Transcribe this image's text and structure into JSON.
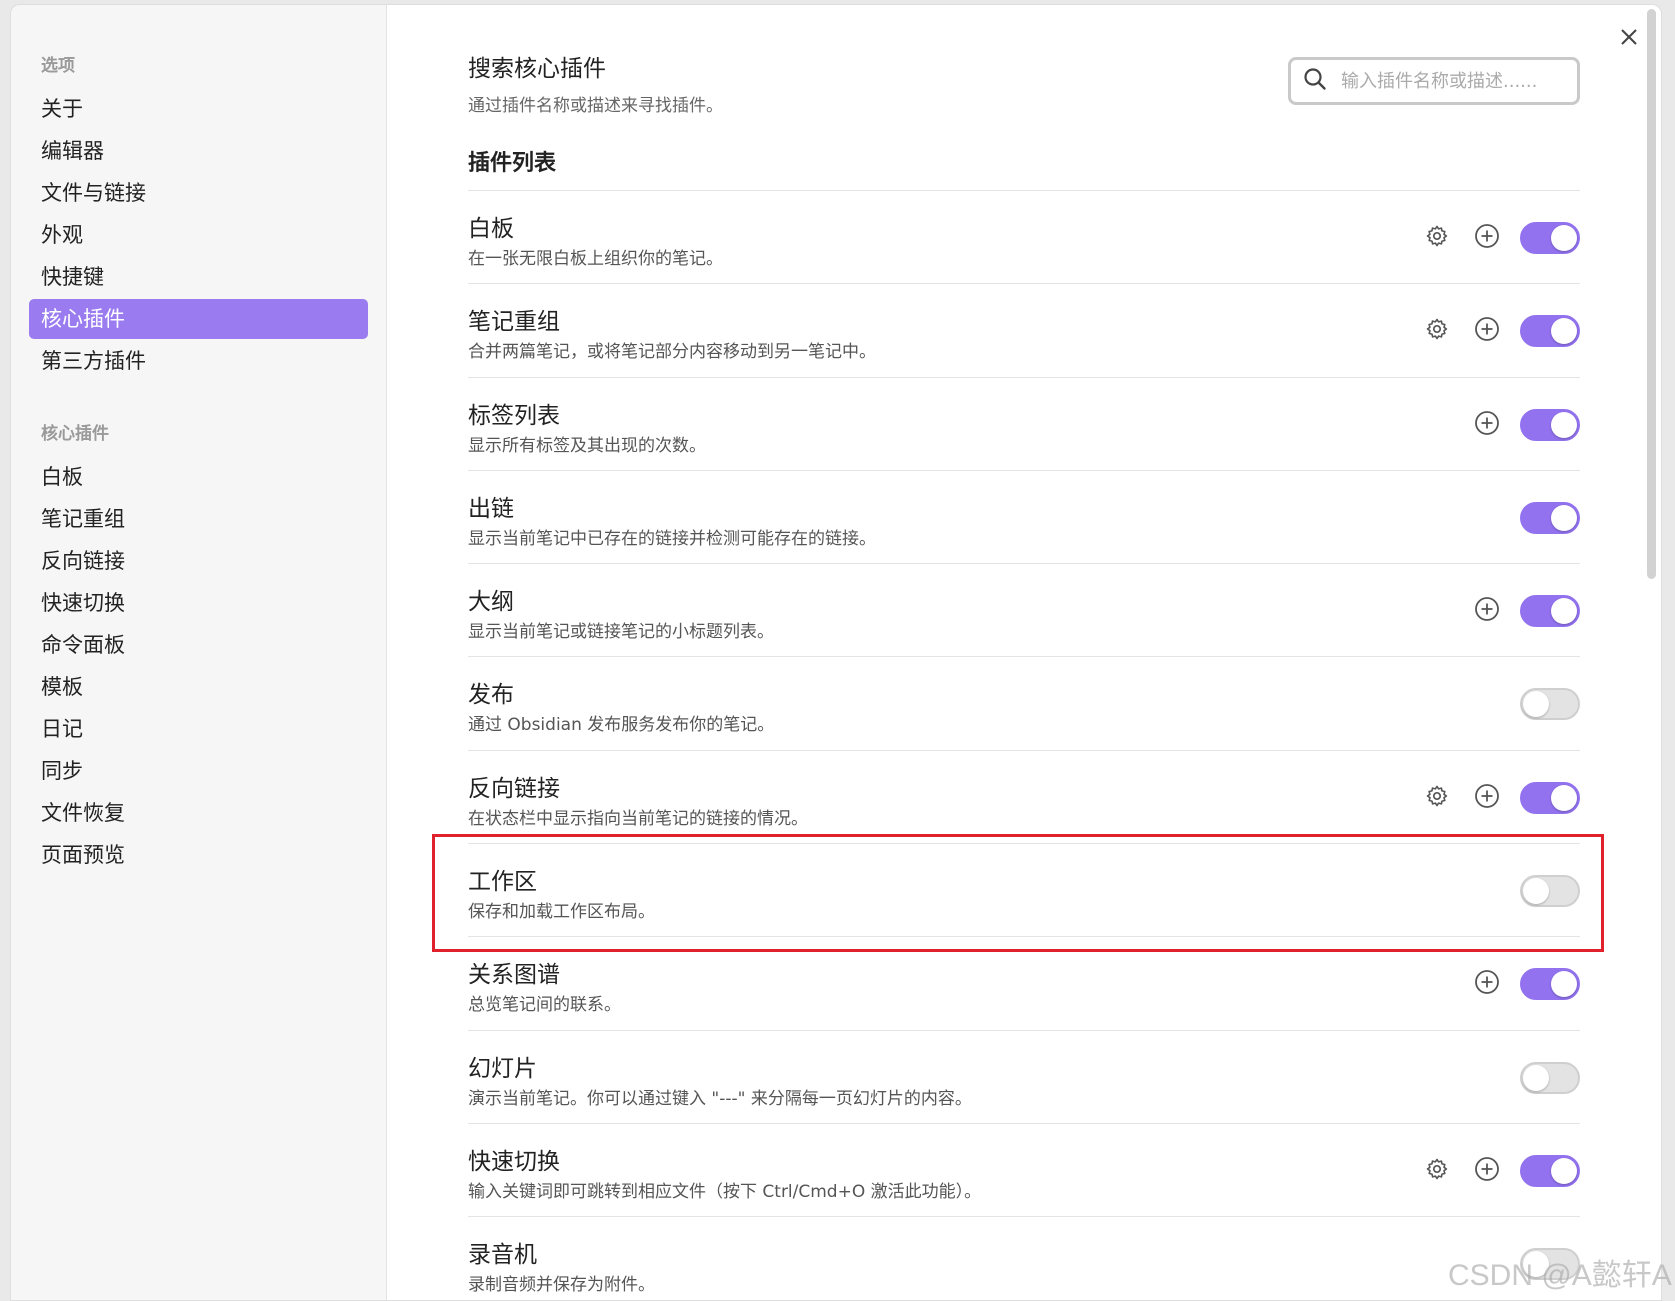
{
  "sidebar": {
    "heading_options": "选项",
    "options": [
      "关于",
      "编辑器",
      "文件与链接",
      "外观",
      "快捷键",
      "核心插件",
      "第三方插件"
    ],
    "active_option": "核心插件",
    "heading_core": "核心插件",
    "core_plugins": [
      "白板",
      "笔记重组",
      "反向链接",
      "快速切换",
      "命令面板",
      "模板",
      "日记",
      "同步",
      "文件恢复",
      "页面预览"
    ]
  },
  "search": {
    "title": "搜索核心插件",
    "description": "通过插件名称或描述来寻找插件。",
    "placeholder": "输入插件名称或描述......"
  },
  "list_title": "插件列表",
  "plugins": [
    {
      "name": "白板",
      "desc": "在一张无限白板上组织你的笔记。",
      "settings": true,
      "hotkey": true,
      "enabled": true
    },
    {
      "name": "笔记重组",
      "desc": "合并两篇笔记，或将笔记部分内容移动到另一笔记中。",
      "settings": true,
      "hotkey": true,
      "enabled": true
    },
    {
      "name": "标签列表",
      "desc": "显示所有标签及其出现的次数。",
      "settings": false,
      "hotkey": true,
      "enabled": true
    },
    {
      "name": "出链",
      "desc": "显示当前笔记中已存在的链接并检测可能存在的链接。",
      "settings": false,
      "hotkey": false,
      "enabled": true
    },
    {
      "name": "大纲",
      "desc": "显示当前笔记或链接笔记的小标题列表。",
      "settings": false,
      "hotkey": true,
      "enabled": true
    },
    {
      "name": "发布",
      "desc": "通过 Obsidian 发布服务发布你的笔记。",
      "settings": false,
      "hotkey": false,
      "enabled": false
    },
    {
      "name": "反向链接",
      "desc": "在状态栏中显示指向当前笔记的链接的情况。",
      "settings": true,
      "hotkey": true,
      "enabled": true
    },
    {
      "name": "工作区",
      "desc": "保存和加载工作区布局。",
      "settings": false,
      "hotkey": false,
      "enabled": false
    },
    {
      "name": "关系图谱",
      "desc": "总览笔记间的联系。",
      "settings": false,
      "hotkey": true,
      "enabled": true
    },
    {
      "name": "幻灯片",
      "desc": "演示当前笔记。你可以通过键入 \"---\" 来分隔每一页幻灯片的内容。",
      "settings": false,
      "hotkey": false,
      "enabled": false
    },
    {
      "name": "快速切换",
      "desc": "输入关键词即可跳转到相应文件（按下 Ctrl/Cmd+O 激活此功能）。",
      "settings": true,
      "hotkey": true,
      "enabled": true
    },
    {
      "name": "录音机",
      "desc": "录制音频并保存为附件。",
      "settings": false,
      "hotkey": false,
      "enabled": false
    }
  ],
  "watermark": "CSDN @A懿轩A",
  "colors": {
    "accent": "#9272ef",
    "sidebar_active": "#9a7cf0",
    "highlight": "#e0202a"
  },
  "icons": {
    "settings": "gear-icon",
    "hotkey": "plus-circle-icon",
    "close": "close-icon",
    "search": "search-icon"
  }
}
